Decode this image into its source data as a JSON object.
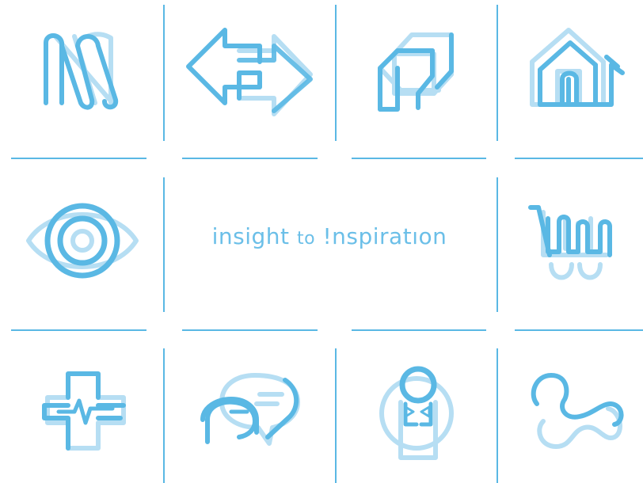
{
  "brand": {
    "word1": "insight",
    "word2": "to",
    "word3": "!nspiratıon"
  },
  "colors": {
    "primary": "#5ab8e4",
    "light": "#b6def3"
  },
  "icons": [
    "abstract-lines-icon",
    "exchange-arrows-icon",
    "cube-icon",
    "house-icon",
    "eye-icon",
    "shopping-cart-icon",
    "medical-cross-icon",
    "chat-bubbles-icon",
    "person-bowtie-icon",
    "path-route-icon"
  ]
}
